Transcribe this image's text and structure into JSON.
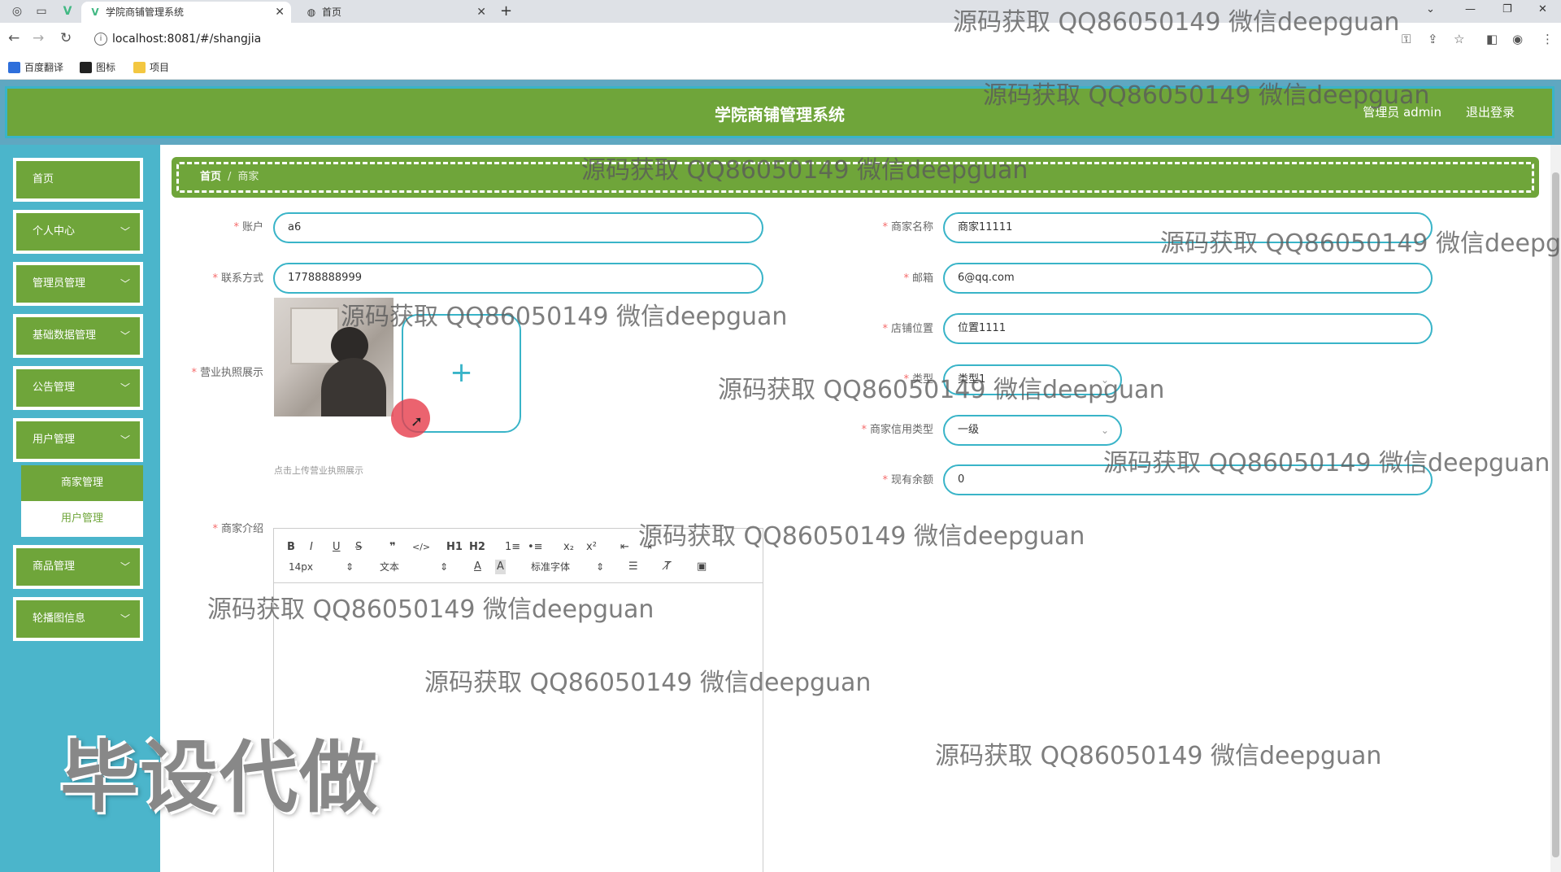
{
  "browser": {
    "tabs": [
      {
        "title": "学院商铺管理系统",
        "active": true
      },
      {
        "title": "首页",
        "active": false
      }
    ],
    "url": "localhost:8081/#/shangjia",
    "bookmarks": [
      "百度翻译",
      "图标",
      "项目"
    ]
  },
  "header": {
    "title": "学院商铺管理系统",
    "user": "管理员 admin",
    "logout": "退出登录"
  },
  "sidebar": {
    "items": [
      {
        "label": "首页",
        "has_children": false
      },
      {
        "label": "个人中心",
        "has_children": true
      },
      {
        "label": "管理员管理",
        "has_children": true
      },
      {
        "label": "基础数据管理",
        "has_children": true
      },
      {
        "label": "公告管理",
        "has_children": true
      },
      {
        "label": "用户管理",
        "has_children": true
      },
      {
        "label": "商品管理",
        "has_children": true
      },
      {
        "label": "轮播图信息",
        "has_children": true
      }
    ],
    "submenu": [
      {
        "label": "商家管理",
        "active": true
      },
      {
        "label": "用户管理",
        "active": false
      }
    ]
  },
  "breadcrumb": {
    "home": "首页",
    "separator": "/",
    "current": "商家"
  },
  "form": {
    "account": {
      "label": "账户",
      "value": "a6"
    },
    "phone": {
      "label": "联系方式",
      "value": "17788888999"
    },
    "license": {
      "label": "营业执照展示",
      "hint": "点击上传营业执照展示",
      "add": "+"
    },
    "intro": {
      "label": "商家介绍"
    },
    "shop_name": {
      "label": "商家名称",
      "value": "商家11111"
    },
    "email": {
      "label": "邮箱",
      "value": "6@qq.com"
    },
    "location": {
      "label": "店铺位置",
      "value": "位置1111"
    },
    "type": {
      "label": "类型",
      "value": "类型1"
    },
    "credit": {
      "label": "商家信用类型",
      "value": "一级"
    },
    "balance": {
      "label": "现有余额",
      "value": "0"
    }
  },
  "editor_toolbar": {
    "row1": [
      "B",
      "I",
      "U",
      "S",
      "❞",
      "</>",
      "H1",
      "H2",
      "1≡",
      "•≡",
      "x₂",
      "x²",
      "⇤",
      "⇥"
    ],
    "font_size": "14px",
    "header": "文本",
    "font": "标准字体"
  },
  "watermark": {
    "text": "源码获取 QQ86050149 微信deepguan",
    "big": "毕设代做"
  },
  "colors": {
    "green": "#6fa53a",
    "teal": "#4bb5cb",
    "accent_border": "#39b4c8",
    "required": "#f56c6c"
  }
}
